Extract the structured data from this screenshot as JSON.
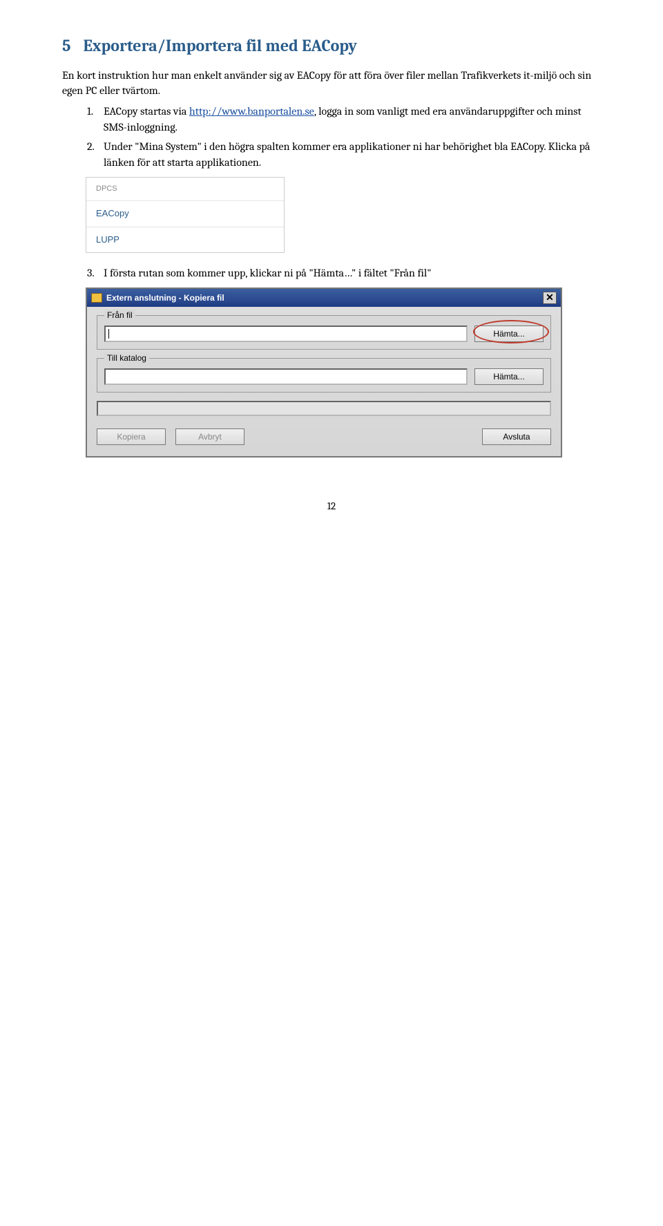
{
  "heading": {
    "num": "5",
    "title": "Exportera/Importera fil med EACopy"
  },
  "intro": "En kort instruktion hur man enkelt använder sig av EACopy för att föra över filer mellan Trafikverkets it-miljö och sin egen PC eller tvärtom.",
  "steps": {
    "s1": {
      "n": "1.",
      "pre": "EACopy startas via ",
      "link": "http://www.banportalen.se",
      "post": ", logga in som vanligt med era användaruppgifter och minst SMS-inloggning."
    },
    "s2": {
      "n": "2.",
      "t": "Under \"Mina System\" i den högra spalten kommer era applikationer ni har behörighet bla EACopy. Klicka på länken för att starta applikationen."
    },
    "s3": {
      "n": "3.",
      "t": "I första rutan som kommer upp, klickar ni på \"Hämta…\" i fältet \"Från fil\""
    }
  },
  "shot1": {
    "r0": "DPCS",
    "r1": "EACopy",
    "r2": "LUPP"
  },
  "dlg": {
    "title": "Extern anslutning - Kopiera fil",
    "close": "✕",
    "group1": {
      "legend": "Från fil",
      "btn": "Hämta..."
    },
    "group2": {
      "legend": "Till katalog",
      "btn": "Hämta..."
    },
    "copy": "Kopiera",
    "cancel": "Avbryt",
    "exit": "Avsluta"
  },
  "page": "12"
}
